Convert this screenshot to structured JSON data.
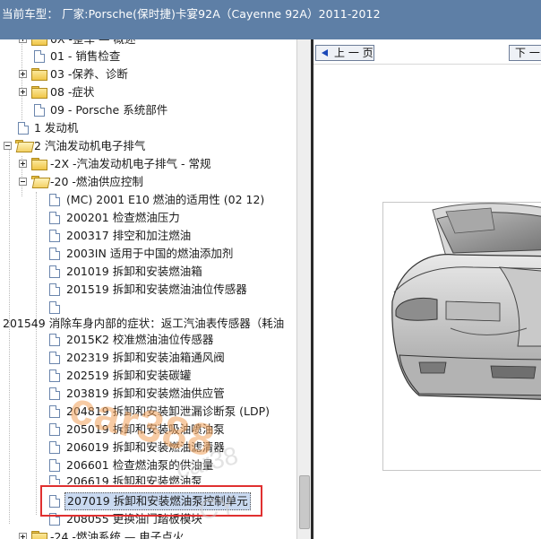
{
  "window": {
    "title": "当前车型：  厂家:Porsche(保时捷)卡宴92A（Cayenne 92A）2011-2012"
  },
  "tree": {
    "items": [
      {
        "label": "0X -整车 — 概述"
      },
      {
        "label": "01 - 销售检查"
      },
      {
        "label": "03 -保养、诊断"
      },
      {
        "label": "08 -症状"
      },
      {
        "label": "09 - Porsche 系统部件"
      },
      {
        "label": "1 发动机"
      },
      {
        "label": "2 汽油发动机电子排气"
      },
      {
        "label": "-2X -汽油发动机电子排气 - 常规"
      },
      {
        "label": "-20 -燃油供应控制"
      },
      {
        "label": "(MC) 2001 E10 燃油的适用性 (02 12)"
      },
      {
        "label": "200201 检查燃油压力"
      },
      {
        "label": "200317 排空和加注燃油"
      },
      {
        "label": "2003IN 适用于中国的燃油添加剂"
      },
      {
        "label": "201019 拆卸和安装燃油箱"
      },
      {
        "label": "201519 拆卸和安装燃油油位传感器"
      },
      {
        "label": "201549 消除车身内部的症状：返工汽油表传感器（耗油"
      },
      {
        "label": "2015K2 校准燃油油位传感器"
      },
      {
        "label": "202319 拆卸和安装油箱通风阀"
      },
      {
        "label": "202519 拆卸和安装碳罐"
      },
      {
        "label": "203819 拆卸和安装燃油供应管"
      },
      {
        "label": "204819 拆卸和安装卸泄漏诊断泵 (LDP)"
      },
      {
        "label": "205019 拆卸和安装吸油喷油泵"
      },
      {
        "label": "206019 拆卸和安装燃油滤清器"
      },
      {
        "label": "206601 检查燃油泵的供油量"
      },
      {
        "label": "206619 拆卸和安装燃油泵"
      },
      {
        "label": "207019 拆卸和安装燃油泵控制单元"
      },
      {
        "label": "208055 更换油门踏板模块"
      },
      {
        "label": "-24 -燃油系统 — 电子点火"
      }
    ]
  },
  "viewer": {
    "prev_label": "上 一 页",
    "next_label": "下 一",
    "watermark_main": "car388",
    "watermark_faint_1": "car38",
    "watermark_faint_2": "CY"
  },
  "colors": {
    "titlebar_bg": "#5e7fa6",
    "highlight_border": "#e03030",
    "selected_bg": "#c9d9f0"
  }
}
